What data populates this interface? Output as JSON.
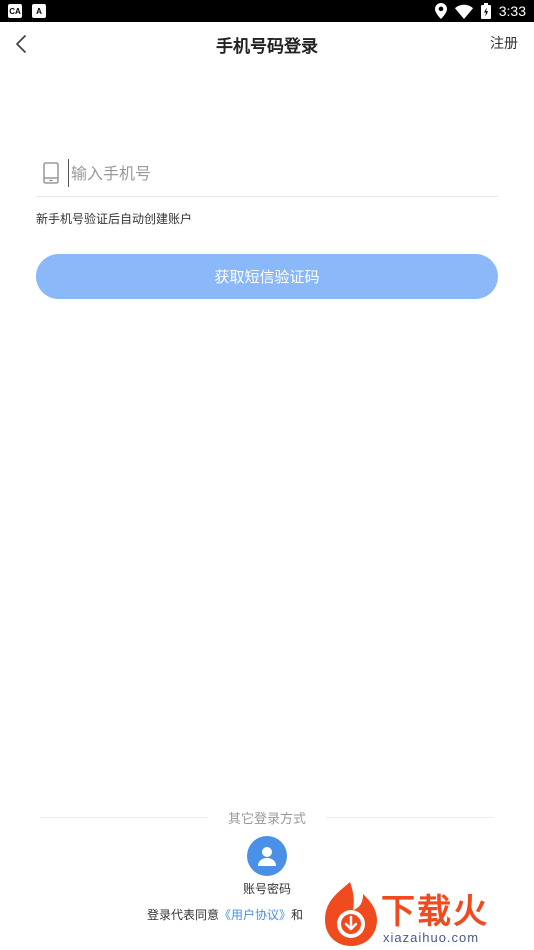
{
  "status_bar": {
    "left_icons": [
      "notification-app-icon",
      "notification-a-icon"
    ],
    "badge1": "CA",
    "badge2": "A",
    "right_icons": [
      "location-icon",
      "wifi-icon",
      "battery-icon"
    ],
    "time": "3:33"
  },
  "nav": {
    "back_icon": "chevron-left-icon",
    "title": "手机号码登录",
    "register": "注册"
  },
  "form": {
    "phone_icon": "phone-icon",
    "phone_value": "",
    "phone_placeholder": "输入手机号",
    "hint": "新手机号验证后自动创建账户",
    "sms_button": "获取短信验证码"
  },
  "other_login": {
    "label": "其它登录方式",
    "account_icon": "user-icon",
    "account_label": "账号密码"
  },
  "agreement": {
    "prefix": "登录代表同意",
    "link": "《用户协议》",
    "suffix": "和"
  },
  "watermark": {
    "text": "下载火",
    "url": "xiazaihuo.com"
  },
  "colors": {
    "primary": "#4a90e6",
    "button_disabled": "#8ab8f8",
    "watermark": "#f04a1f"
  }
}
